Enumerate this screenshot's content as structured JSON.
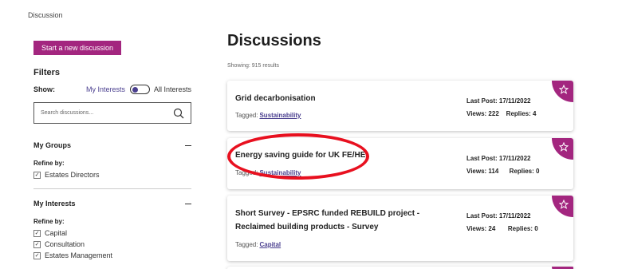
{
  "breadcrumb": "Discussion",
  "sidebar": {
    "new_discussion_label": "Start a new discussion",
    "filters_title": "Filters",
    "show_label": "Show:",
    "toggle_left": "My Interests",
    "toggle_right": "All Interests",
    "search_placeholder": "Search discussions...",
    "groups": [
      {
        "title": "My Groups",
        "refine": "Refine by:",
        "items": [
          "Estates Directors"
        ]
      },
      {
        "title": "My Interests",
        "refine": "Refine by:",
        "items": [
          "Capital",
          "Consultation",
          "Estates Management"
        ]
      }
    ]
  },
  "main": {
    "title": "Discussions",
    "results": "Showing: 915 results",
    "tagged_label": "Tagged:",
    "cards": [
      {
        "title": "Grid decarbonisation",
        "tag": "Sustainability",
        "last_post": "Last Post: 17/11/2022",
        "views": "Views: 222",
        "replies": "Replies: 4"
      },
      {
        "title": "Energy saving guide for UK FE/HE",
        "tag": "Sustainability",
        "last_post": "Last Post: 17/11/2022",
        "views": "Views: 114",
        "replies": "Replies: 0"
      },
      {
        "title_line1": "Short Survey - EPSRC funded REBUILD project -",
        "title_line2": "Reclaimed building products - Survey",
        "tag": "Capital",
        "last_post": "Last Post: 17/11/2022",
        "views": "Views: 24",
        "replies": "Replies: 0"
      }
    ]
  },
  "colors": {
    "accent": "#a3267f",
    "link": "#4a3f8f",
    "annotation": "#e8101f"
  },
  "icons": {
    "favorite": "star-icon",
    "search": "search-icon",
    "collapse": "minus-icon",
    "checkbox": "check-icon"
  }
}
